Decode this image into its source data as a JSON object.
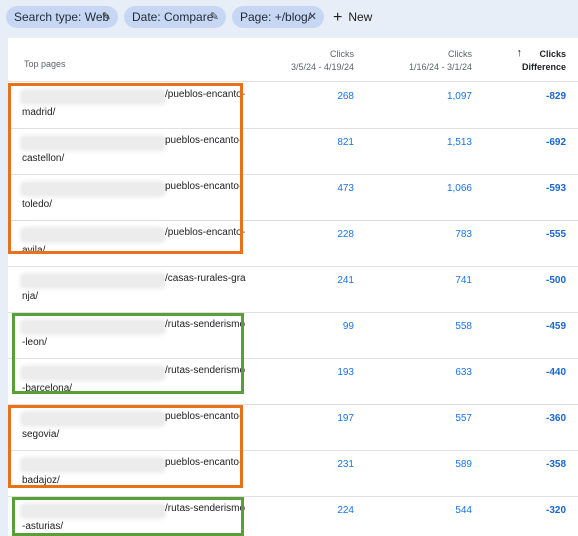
{
  "filters": {
    "chip1": "Search type: Web",
    "chip2": "Date: Compare",
    "chip3": "Page: +/blog/",
    "new_label": "New"
  },
  "table": {
    "col_page": "Top pages",
    "col_clicks1_a": "Clicks",
    "col_clicks1_b": "3/5/24 - 4/19/24",
    "col_clicks2_a": "Clicks",
    "col_clicks2_b": "1/16/24 - 3/1/24",
    "col_diff_a": "Clicks",
    "col_diff_b": "Difference",
    "rows": [
      {
        "url1": "/pueblos-encanto-",
        "url2": "madrid/",
        "c1": "268",
        "c2": "1,097",
        "diff": "-829"
      },
      {
        "url1": "pueblos-encanto-",
        "url2": "castellon/",
        "c1": "821",
        "c2": "1,513",
        "diff": "-692"
      },
      {
        "url1": "pueblos-encanto-",
        "url2": "toledo/",
        "c1": "473",
        "c2": "1,066",
        "diff": "-593"
      },
      {
        "url1": "/pueblos-encanto-",
        "url2": "avila/",
        "c1": "228",
        "c2": "783",
        "diff": "-555"
      },
      {
        "url1": "/casas-rurales-gra",
        "url2": "nja/",
        "c1": "241",
        "c2": "741",
        "diff": "-500"
      },
      {
        "url1": "/rutas-senderismo",
        "url2": "-leon/",
        "c1": "99",
        "c2": "558",
        "diff": "-459"
      },
      {
        "url1": "/rutas-senderismo",
        "url2": "-barcelona/",
        "c1": "193",
        "c2": "633",
        "diff": "-440"
      },
      {
        "url1": "pueblos-encanto-",
        "url2": "segovia/",
        "c1": "197",
        "c2": "557",
        "diff": "-360"
      },
      {
        "url1": "pueblos-encanto-",
        "url2": "badajoz/",
        "c1": "231",
        "c2": "589",
        "diff": "-358"
      },
      {
        "url1": "/rutas-senderismo",
        "url2": "-asturias/",
        "c1": "224",
        "c2": "544",
        "diff": "-320"
      }
    ]
  },
  "icons": {
    "edit": "pencil-icon",
    "close": "close-icon",
    "sort": "arrow-up-icon",
    "add": "plus-icon"
  },
  "colors": {
    "highlight_orange": "#e8711a",
    "highlight_green": "#5a9e3a",
    "link_blue": "#1a73e8"
  }
}
